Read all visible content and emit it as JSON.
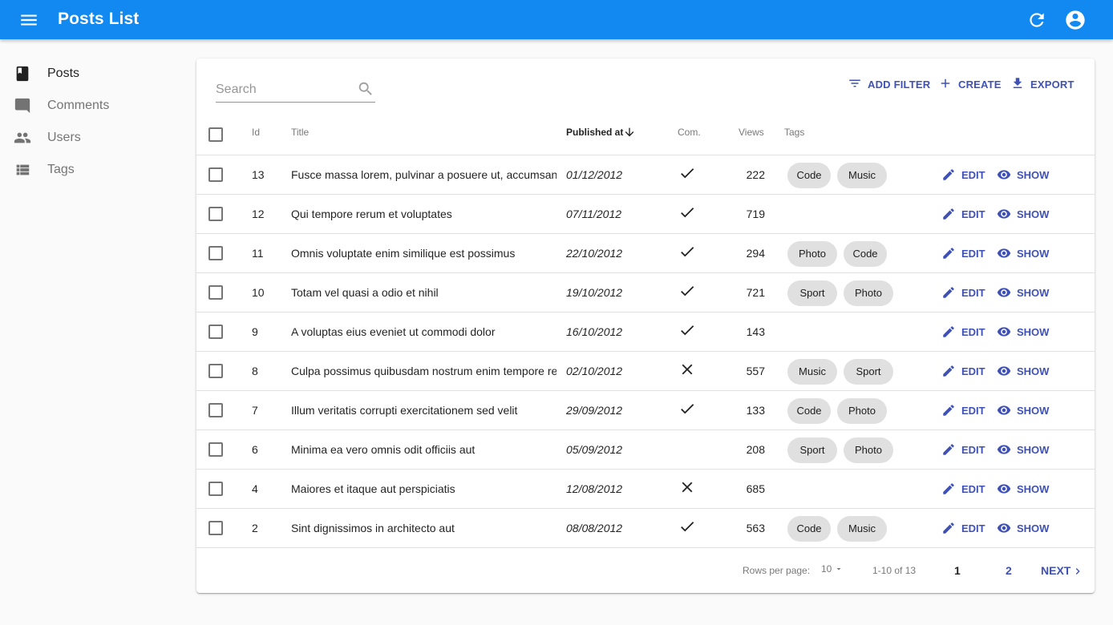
{
  "app": {
    "title": "Posts List"
  },
  "sidebar": {
    "items": [
      {
        "label": "Posts",
        "icon": "book-icon"
      },
      {
        "label": "Comments",
        "icon": "comment-icon"
      },
      {
        "label": "Users",
        "icon": "people-icon"
      },
      {
        "label": "Tags",
        "icon": "list-icon"
      }
    ]
  },
  "search": {
    "placeholder": "Search",
    "value": ""
  },
  "toolbar": {
    "add_filter": "ADD FILTER",
    "create": "CREATE",
    "export": "EXPORT"
  },
  "table": {
    "headers": {
      "id": "Id",
      "title": "Title",
      "published_at": "Published at",
      "commentable": "Com.",
      "views": "Views",
      "tags": "Tags"
    },
    "sort": {
      "field": "published_at",
      "order": "desc"
    },
    "rows": [
      {
        "id": "13",
        "title": "Fusce massa lorem, pulvinar a posuere ut, accumsan",
        "published_at": "01/12/2012",
        "commentable": "yes",
        "views": "222",
        "tags": [
          "Code",
          "Music"
        ],
        "edit": "EDIT",
        "show": "SHOW"
      },
      {
        "id": "12",
        "title": "Qui tempore rerum et voluptates",
        "published_at": "07/11/2012",
        "commentable": "yes",
        "views": "719",
        "tags": [],
        "edit": "EDIT",
        "show": "SHOW"
      },
      {
        "id": "11",
        "title": "Omnis voluptate enim similique est possimus",
        "published_at": "22/10/2012",
        "commentable": "yes",
        "views": "294",
        "tags": [
          "Photo",
          "Code"
        ],
        "edit": "EDIT",
        "show": "SHOW"
      },
      {
        "id": "10",
        "title": "Totam vel quasi a odio et nihil",
        "published_at": "19/10/2012",
        "commentable": "yes",
        "views": "721",
        "tags": [
          "Sport",
          "Photo"
        ],
        "edit": "EDIT",
        "show": "SHOW"
      },
      {
        "id": "9",
        "title": "A voluptas eius eveniet ut commodi dolor",
        "published_at": "16/10/2012",
        "commentable": "yes",
        "views": "143",
        "tags": [],
        "edit": "EDIT",
        "show": "SHOW"
      },
      {
        "id": "8",
        "title": "Culpa possimus quibusdam nostrum enim tempore re",
        "published_at": "02/10/2012",
        "commentable": "no",
        "views": "557",
        "tags": [
          "Music",
          "Sport"
        ],
        "edit": "EDIT",
        "show": "SHOW"
      },
      {
        "id": "7",
        "title": "Illum veritatis corrupti exercitationem sed velit",
        "published_at": "29/09/2012",
        "commentable": "yes",
        "views": "133",
        "tags": [
          "Code",
          "Photo"
        ],
        "edit": "EDIT",
        "show": "SHOW"
      },
      {
        "id": "6",
        "title": "Minima ea vero omnis odit officiis aut",
        "published_at": "05/09/2012",
        "commentable": "",
        "views": "208",
        "tags": [
          "Sport",
          "Photo"
        ],
        "edit": "EDIT",
        "show": "SHOW"
      },
      {
        "id": "4",
        "title": "Maiores et itaque aut perspiciatis",
        "published_at": "12/08/2012",
        "commentable": "no",
        "views": "685",
        "tags": [],
        "edit": "EDIT",
        "show": "SHOW"
      },
      {
        "id": "2",
        "title": "Sint dignissimos in architecto aut",
        "published_at": "08/08/2012",
        "commentable": "yes",
        "views": "563",
        "tags": [
          "Code",
          "Music"
        ],
        "edit": "EDIT",
        "show": "SHOW"
      }
    ]
  },
  "pagination": {
    "rows_per_page_label": "Rows per page:",
    "rows_per_page": "10",
    "range": "1-10 of 13",
    "pages": [
      "1",
      "2"
    ],
    "current_page": "1",
    "next": "NEXT"
  },
  "colors": {
    "appbar": "#1289f0",
    "accent": "#3f51b5",
    "chip": "#e0e0e0"
  }
}
